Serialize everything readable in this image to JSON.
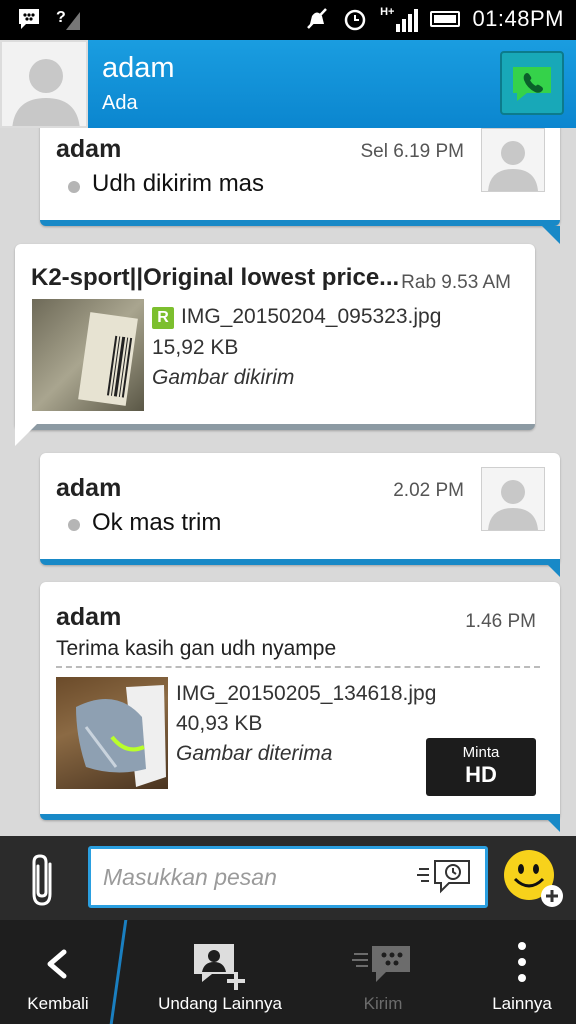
{
  "status_bar": {
    "time": "01:48PM",
    "network": "H+",
    "icons": [
      "bbm-icon",
      "signal-question-icon",
      "mute-icon",
      "alarm-icon",
      "signal-icon",
      "battery-icon"
    ]
  },
  "header": {
    "contact_name": "adam",
    "contact_status": "Ada",
    "call_icon": "phone-icon"
  },
  "messages": [
    {
      "direction": "incoming",
      "sender": "adam",
      "time": "Sel 6.19 PM",
      "text": "Udh dikirim mas"
    },
    {
      "direction": "outgoing",
      "sender": "K2-sport||Original lowest price...",
      "time": "Rab 9.53 AM",
      "file_name": "IMG_20150204_095323.jpg",
      "file_size": "15,92 KB",
      "file_status": "Gambar dikirim"
    },
    {
      "direction": "incoming",
      "sender": "adam",
      "time": "2.02 PM",
      "text": "Ok mas trim"
    },
    {
      "direction": "incoming",
      "sender": "adam",
      "time": "1.46 PM",
      "text": "Terima kasih gan udh nyampe",
      "file_name": "IMG_20150205_134618.jpg",
      "file_size": "40,93 KB",
      "file_status": "Gambar diterima",
      "hd_button": {
        "top": "Minta",
        "bottom": "HD"
      }
    }
  ],
  "composer": {
    "placeholder": "Masukkan pesan",
    "attach_icon": "paperclip-icon",
    "emoji_icon": "smiley-icon"
  },
  "bottom_nav": {
    "back": "Kembali",
    "invite": "Undang Lainnya",
    "send": "Kirim",
    "more": "Lainnya"
  },
  "colors": {
    "header": "#1a9de0",
    "accent": "#1889c7",
    "bbm_green": "#7cbf2e"
  }
}
